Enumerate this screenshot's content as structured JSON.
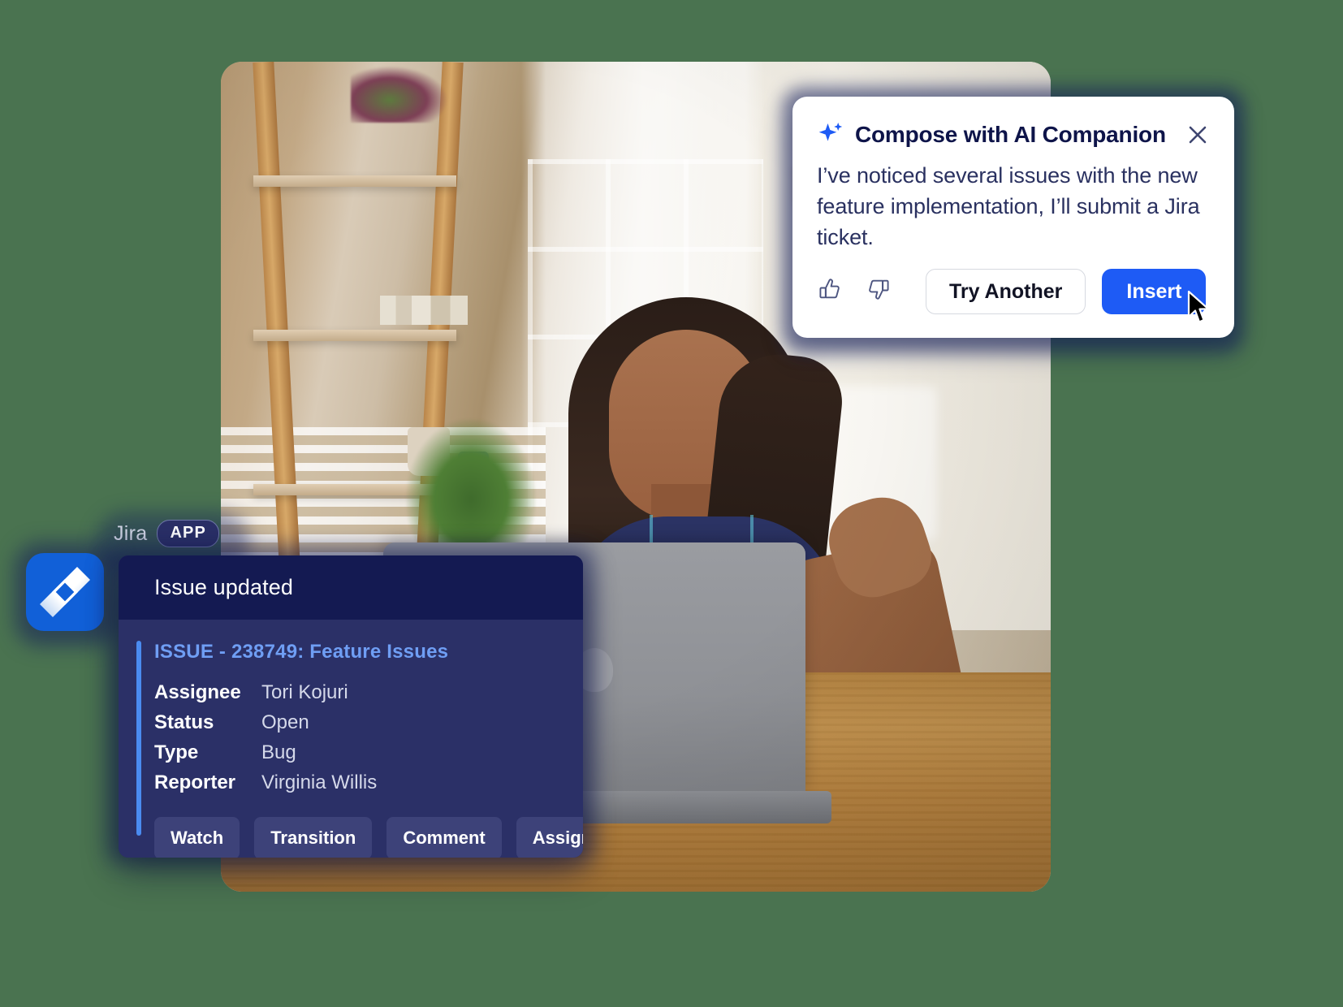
{
  "theme": {
    "background": "#4a7350",
    "accent_blue": "#1e5bf5",
    "jira_blue": "#1160d8",
    "card_navy": "#2b3067",
    "card_navy_dark": "#141a52",
    "link_blue": "#6f9ef4",
    "accent_bar": "#4a8bf0"
  },
  "ai_card": {
    "icon": "sparkle-ai-icon",
    "title": "Compose with AI Companion",
    "close_icon": "close-icon",
    "message": "I’ve noticed several issues with the new feature implementation, I’ll submit a Jira ticket.",
    "thumbs_up_icon": "thumbs-up-icon",
    "thumbs_down_icon": "thumbs-down-icon",
    "try_another_label": "Try Another",
    "insert_label": "Insert",
    "cursor_icon": "mouse-pointer-icon"
  },
  "jira_chip": {
    "app_name": "Jira",
    "app_badge": "APP",
    "logo_icon": "jira-logo-icon"
  },
  "jira_card": {
    "header_title": "Issue updated",
    "issue_link": "ISSUE - 238749: Feature Issues",
    "fields": [
      {
        "key": "Assignee",
        "value": "Tori Kojuri"
      },
      {
        "key": "Status",
        "value": "Open"
      },
      {
        "key": "Type",
        "value": "Bug"
      },
      {
        "key": "Reporter",
        "value": "Virginia Willis"
      }
    ],
    "buttons": [
      "Watch",
      "Transition",
      "Comment",
      "Assign"
    ]
  },
  "photo": {
    "alt": "Woman smiling at laptop in a bright home office with a ladder shelf, plants and a wooden desk"
  }
}
